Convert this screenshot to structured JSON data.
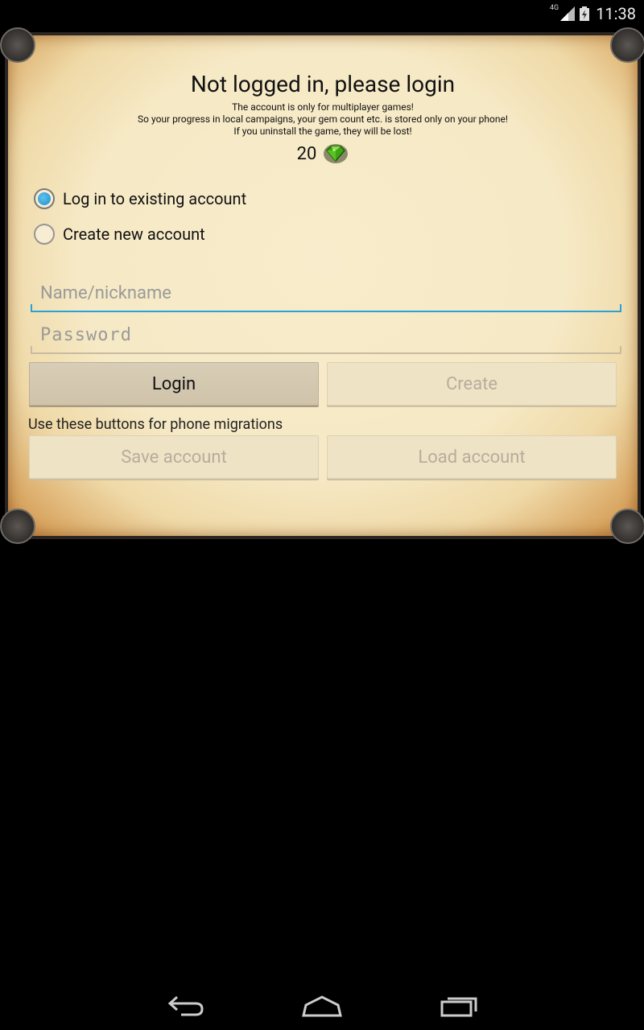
{
  "status_bar": {
    "network": "4G",
    "time": "11:38"
  },
  "dialog": {
    "title": "Not logged in, please login",
    "info_lines": [
      "The account is only for multiplayer games!",
      "So your progress in local campaigns, your gem count etc. is stored only on your phone!",
      "If you uninstall the game, they will be lost!"
    ],
    "gem_count": "20",
    "gem_icon": "green-gem-icon",
    "options": [
      {
        "label": "Log in to existing account",
        "selected": true
      },
      {
        "label": "Create new account",
        "selected": false
      }
    ],
    "name_field": {
      "placeholder": "Name/nickname",
      "value": ""
    },
    "password_field": {
      "placeholder": "Password",
      "value": ""
    },
    "buttons": {
      "login": {
        "label": "Login",
        "enabled": true
      },
      "create": {
        "label": "Create",
        "enabled": false
      },
      "save_account": {
        "label": "Save account",
        "enabled": false
      },
      "load_account": {
        "label": "Load account",
        "enabled": false
      }
    },
    "migration_hint": "Use these buttons for phone migrations"
  },
  "nav_bar": {
    "icons": [
      "back-icon",
      "home-icon",
      "recents-icon"
    ]
  },
  "colors": {
    "accent": "#2aa2d6",
    "parchment": "#f6e9c5"
  }
}
